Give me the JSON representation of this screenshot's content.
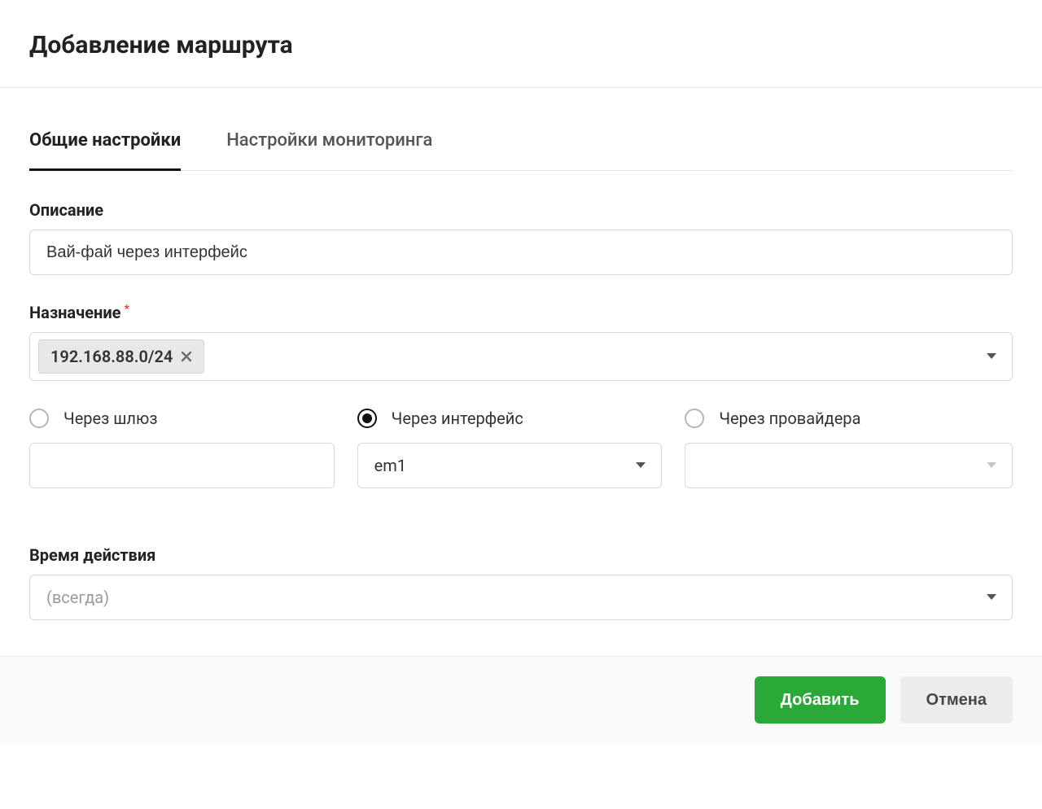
{
  "header": {
    "title": "Добавление маршрута"
  },
  "tabs": [
    {
      "label": "Общие настройки",
      "active": true
    },
    {
      "label": "Настройки мониторинга",
      "active": false
    }
  ],
  "fields": {
    "description": {
      "label": "Описание",
      "value": "Вай-фай через интерфейс"
    },
    "destination": {
      "label": "Назначение",
      "required": true,
      "chip": "192.168.88.0/24"
    },
    "via": {
      "gateway": {
        "label": "Через шлюз",
        "value": ""
      },
      "interface": {
        "label": "Через интерфейс",
        "value": "em1"
      },
      "provider": {
        "label": "Через провайдера",
        "value": ""
      }
    },
    "time": {
      "label": "Время действия",
      "placeholder": "(всегда)"
    }
  },
  "footer": {
    "submit": "Добавить",
    "cancel": "Отмена"
  }
}
